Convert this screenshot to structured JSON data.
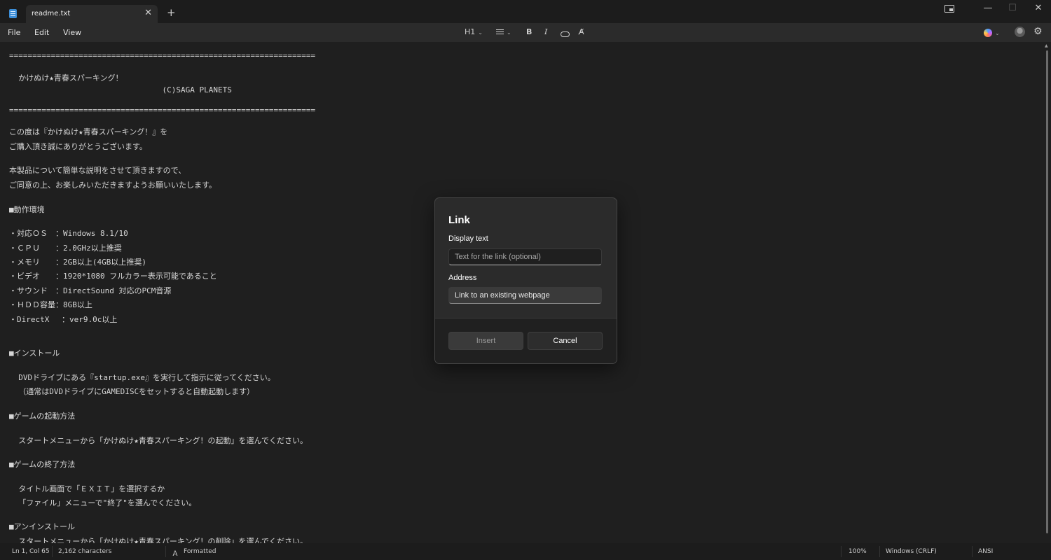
{
  "window": {
    "tab_title": "readme.txt",
    "close_tab": "✕",
    "new_tab": "+",
    "minimize": "—",
    "maximize": "☐",
    "close": "✕"
  },
  "menu": {
    "file": "File",
    "edit": "Edit",
    "view": "View"
  },
  "toolbar": {
    "heading": "H1",
    "chevron": "⌄",
    "bold": "B",
    "italic": "I",
    "clear_format": "A̸",
    "gear": "⚙"
  },
  "editor": {
    "lines": [
      "==================================================================",
      "  かけぬけ★青春スパーキング！",
      "                                 (C)SAGA PLANETS",
      "==================================================================",
      "この度は『かけぬけ★青春スパーキング！』を",
      "ご購入頂き誠にありがとうございます。",
      "本製品について簡単な説明をさせて頂きますので、",
      "ご同意の上、お楽しみいただきますようお願いいたします。",
      "■動作環境",
      "・対応ＯＳ　：Windows 8.1/10",
      "・ＣＰＵ　　：2.0GHz以上推奨",
      "・メモリ　　：2GB以上(4GB以上推奨)",
      "・ビデオ　　：1920*1080 フルカラー表示可能であること",
      "・サウンド　：DirectSound 対応のPCM音源",
      "・ＨＤＤ容量：8GB以上",
      "・DirectX　 ：ver9.0c以上",
      "■インストール",
      "  DVDドライブにある『startup.exe』を実行して指示に従ってください。",
      "  （通常はDVDドライブにGAMEDISCをセットすると自動起動します）",
      "■ゲームの起動方法",
      "  スタートメニューから「かけぬけ★青春スパーキング！の起動」を選んでください。",
      "■ゲームの終了方法",
      "  タイトル画面で「ＥＸＩＴ」を選択するか",
      "  「ファイル」メニューで\"終了\"を選んでください。",
      "■アンインストール",
      "  スタートメニューから「かけぬけ★青春スパーキング！の削除」を選んでください。"
    ]
  },
  "dialog": {
    "title": "Link",
    "display_label": "Display text",
    "display_placeholder": "Text for the link (optional)",
    "address_label": "Address",
    "address_placeholder": "Link to an existing webpage",
    "insert": "Insert",
    "cancel": "Cancel"
  },
  "status": {
    "position": "Ln 1, Col 65",
    "characters": "2,162 characters",
    "formatted": "Formatted",
    "zoom": "100%",
    "line_endings": "Windows (CRLF)",
    "encoding": "ANSI"
  }
}
